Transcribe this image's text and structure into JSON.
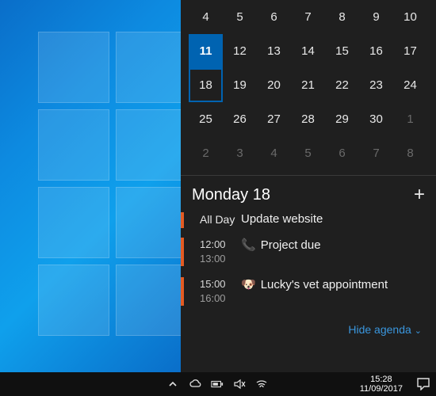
{
  "calendar": {
    "today": 11,
    "selected": 18,
    "weeks": [
      [
        {
          "n": 4
        },
        {
          "n": 5
        },
        {
          "n": 6
        },
        {
          "n": 7
        },
        {
          "n": 8
        },
        {
          "n": 9
        },
        {
          "n": 10
        }
      ],
      [
        {
          "n": 11
        },
        {
          "n": 12
        },
        {
          "n": 13
        },
        {
          "n": 14
        },
        {
          "n": 15
        },
        {
          "n": 16
        },
        {
          "n": 17
        }
      ],
      [
        {
          "n": 18
        },
        {
          "n": 19
        },
        {
          "n": 20
        },
        {
          "n": 21
        },
        {
          "n": 22
        },
        {
          "n": 23
        },
        {
          "n": 24
        }
      ],
      [
        {
          "n": 25
        },
        {
          "n": 26
        },
        {
          "n": 27
        },
        {
          "n": 28
        },
        {
          "n": 29
        },
        {
          "n": 30
        },
        {
          "n": 1,
          "dim": true
        }
      ],
      [
        {
          "n": 2,
          "dim": true
        },
        {
          "n": 3,
          "dim": true
        },
        {
          "n": 4,
          "dim": true
        },
        {
          "n": 5,
          "dim": true
        },
        {
          "n": 6,
          "dim": true
        },
        {
          "n": 7,
          "dim": true
        },
        {
          "n": 8,
          "dim": true
        }
      ]
    ]
  },
  "agenda": {
    "header": "Monday 18",
    "add_label": "+",
    "events": [
      {
        "type": "allday",
        "time_label": "All Day",
        "title": "Update website",
        "icon": ""
      },
      {
        "type": "timed",
        "start": "12:00",
        "end": "13:00",
        "title": "Project due",
        "icon": "📞"
      },
      {
        "type": "timed",
        "start": "15:00",
        "end": "16:00",
        "title": "Lucky's vet appointment",
        "icon": "🐶"
      }
    ],
    "hide_label": "Hide agenda"
  },
  "taskbar": {
    "tray_icons": [
      "chevron-up-icon",
      "cloud-icon",
      "battery-icon",
      "volume-mute-icon",
      "wifi-icon"
    ],
    "clock_time": "15:28",
    "clock_date": "11/09/2017"
  }
}
